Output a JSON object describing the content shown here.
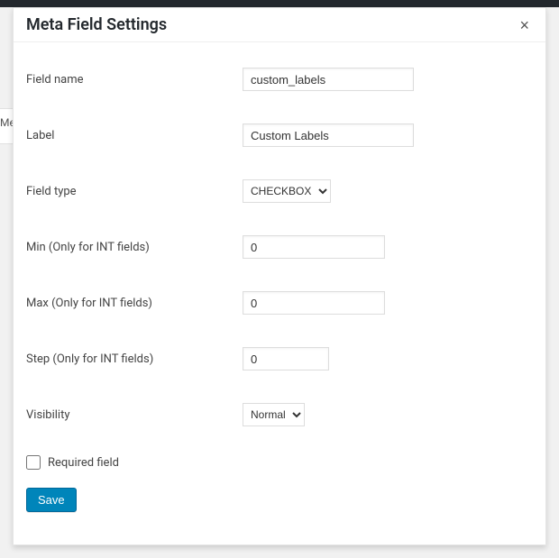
{
  "modal": {
    "title": "Meta Field Settings",
    "close_label": "×"
  },
  "form": {
    "field_name": {
      "label": "Field name",
      "value": "custom_labels"
    },
    "label": {
      "label": "Label",
      "value": "Custom Labels"
    },
    "field_type": {
      "label": "Field type",
      "value": "CHECKBOX",
      "options": [
        "CHECKBOX"
      ]
    },
    "min": {
      "label": "Min (Only for INT fields)",
      "value": "0"
    },
    "max": {
      "label": "Max (Only for INT fields)",
      "value": "0"
    },
    "step": {
      "label": "Step (Only for INT fields)",
      "value": "0"
    },
    "visibility": {
      "label": "Visibility",
      "value": "Normal",
      "options": [
        "Normal"
      ]
    },
    "required": {
      "label": "Required field",
      "checked": false
    },
    "save_label": "Save"
  },
  "bg_stub": "Me"
}
